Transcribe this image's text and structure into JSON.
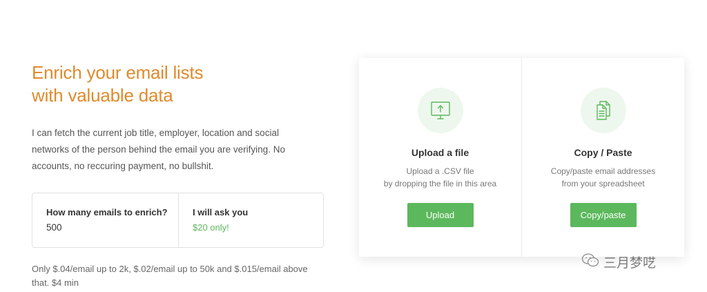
{
  "hero": {
    "title_line1": "Enrich your email lists",
    "title_line2": "with valuable data",
    "description": "I can fetch the current job title, employer, location and social networks of the person behind the email you are verifying. No accounts, no reccuring payment, no bullshit."
  },
  "calculator": {
    "count_label": "How many emails to enrich?",
    "count_value": "500",
    "price_label": "I will ask you",
    "price_value": "$20 only!"
  },
  "pricing_note": "Only $.04/email up to 2k, $.02/email up to 50k and $.015/email above that. $4 min",
  "options": {
    "upload": {
      "title": "Upload a file",
      "desc_line1": "Upload a .CSV file",
      "desc_line2": "by dropping the file in this area",
      "button": "Upload",
      "icon": "monitor-upload-icon"
    },
    "paste": {
      "title": "Copy / Paste",
      "desc_line1": "Copy/paste email addresses",
      "desc_line2": "from your spreadsheet",
      "button": "Copy/paste",
      "icon": "copy-documents-icon"
    }
  },
  "watermark": {
    "text": "三月梦呓",
    "icon": "wechat-icon"
  },
  "colors": {
    "accent": "#e08a2c",
    "button": "#5cb85c",
    "price": "#5cb85c",
    "icon_circle": "#eef7ee"
  }
}
